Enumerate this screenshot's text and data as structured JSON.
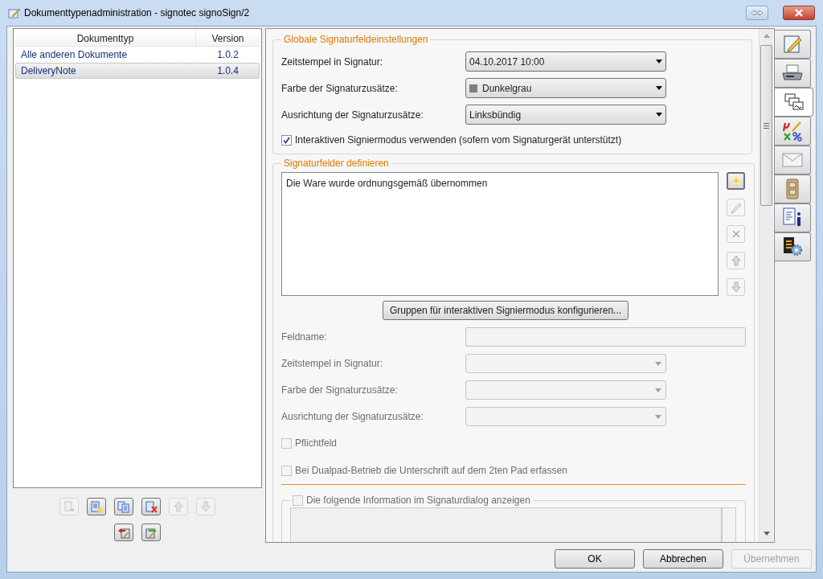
{
  "window": {
    "title": "Dokumenttypenadministration - signotec signoSign/2"
  },
  "document_list": {
    "columns": [
      "Dokumenttyp",
      "Version"
    ],
    "rows": [
      {
        "name": "Alle anderen Dokumente",
        "version": "1.0.2",
        "selected": false
      },
      {
        "name": "DeliveryNote",
        "version": "1.0.4",
        "selected": true
      }
    ]
  },
  "list_toolbar": [
    {
      "kind": "import",
      "disabled": true
    },
    {
      "kind": "new",
      "disabled": false
    },
    {
      "kind": "copy",
      "disabled": false
    },
    {
      "kind": "delete",
      "disabled": false
    },
    {
      "kind": "up",
      "disabled": true
    },
    {
      "kind": "down",
      "disabled": true
    },
    {
      "kind": "export-red",
      "disabled": false
    },
    {
      "kind": "import-green",
      "disabled": false
    }
  ],
  "global_settings": {
    "title": "Globale Signaturfeldeinstellungen",
    "rows": [
      {
        "label": "Zeitstempel in Signatur:",
        "value": "04.10.2017 10:00"
      },
      {
        "label": "Farbe der Signaturzusätze:",
        "value": "Dunkelgrau",
        "color": "#7f7f7f"
      },
      {
        "label": "Ausrichtung der Signaturzusätze:",
        "value": "Linksbündig"
      }
    ],
    "checkbox": {
      "label": "Interaktiven Signiermodus verwenden (sofern vom Signaturgerät unterstützt)",
      "checked": true
    }
  },
  "signature_fields": {
    "title": "Signaturfelder definieren",
    "items": [
      {
        "text": "Die Ware wurde ordnungsgemäß übernommen",
        "selected": false
      }
    ],
    "side_buttons": [
      {
        "kind": "new",
        "disabled": false,
        "focused": true
      },
      {
        "kind": "edit",
        "disabled": true,
        "focused": false
      },
      {
        "kind": "delete",
        "disabled": true,
        "focused": false
      },
      {
        "kind": "up",
        "disabled": true,
        "focused": false
      },
      {
        "kind": "down",
        "disabled": true,
        "focused": false
      }
    ],
    "group_button": "Gruppen für interaktiven Signiermodus konfigurieren...",
    "field_rows": [
      {
        "kind": "input",
        "label": "Feldname:",
        "disabled": true
      },
      {
        "kind": "dropdown",
        "label": "Zeitstempel in Signatur:",
        "disabled": true
      },
      {
        "kind": "dropdown",
        "label": "Farbe der Signaturzusätze:",
        "disabled": true
      },
      {
        "kind": "dropdown",
        "label": "Ausrichtung der Signaturzusätze:",
        "disabled": true
      }
    ],
    "checkboxes": [
      {
        "label": "Pflichtfeld",
        "checked": false,
        "disabled": true
      },
      {
        "label": "Bei Dualpad-Betrieb die Unterschrift auf dem 2ten Pad erfassen",
        "checked": false,
        "disabled": true
      }
    ],
    "info_group": {
      "label": "Die folgende Information im Signaturdialog anzeigen",
      "checked": false,
      "disabled": true
    }
  },
  "side_tabs": [
    {
      "kind": "pen",
      "selected": false
    },
    {
      "kind": "printer",
      "selected": false
    },
    {
      "kind": "signatures",
      "selected": true
    },
    {
      "kind": "symbols",
      "selected": false
    },
    {
      "kind": "envelope",
      "selected": false
    },
    {
      "kind": "cabinet",
      "selected": false
    },
    {
      "kind": "document-info",
      "selected": false
    },
    {
      "kind": "document-gear",
      "selected": false
    }
  ],
  "buttons": [
    {
      "label": "OK",
      "disabled": false
    },
    {
      "label": "Abbrechen",
      "disabled": false
    },
    {
      "label": "Übernehmen",
      "disabled": true
    }
  ]
}
